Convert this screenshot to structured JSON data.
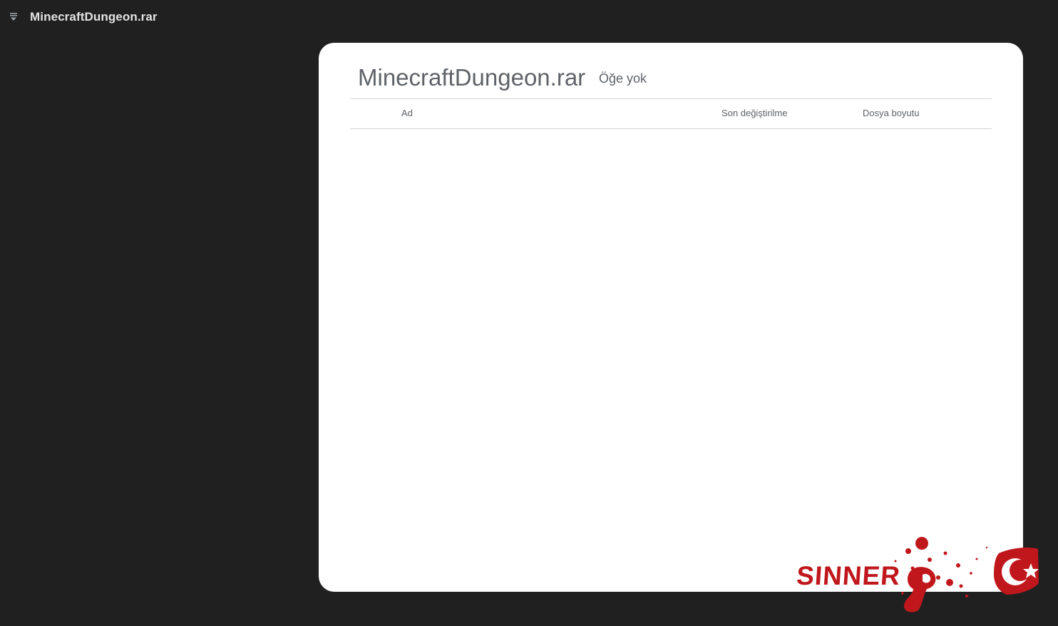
{
  "app": {
    "title": "MinecraftDungeon.rar",
    "menu_icon": "menu-icon"
  },
  "archive": {
    "name": "MinecraftDungeon.rar",
    "item_count_label": "Öğe yok"
  },
  "table": {
    "columns": [
      {
        "key": "name",
        "label": "Ad"
      },
      {
        "key": "modified",
        "label": "Son değiştirilme"
      },
      {
        "key": "size",
        "label": "Dosya boyutu"
      }
    ],
    "rows": []
  },
  "watermark": {
    "text": "SINNER",
    "color": "#c0171c"
  },
  "colors": {
    "background": "#202020",
    "card": "#ffffff",
    "title_text": "#e3e3e3",
    "muted_text": "#5f6368"
  }
}
